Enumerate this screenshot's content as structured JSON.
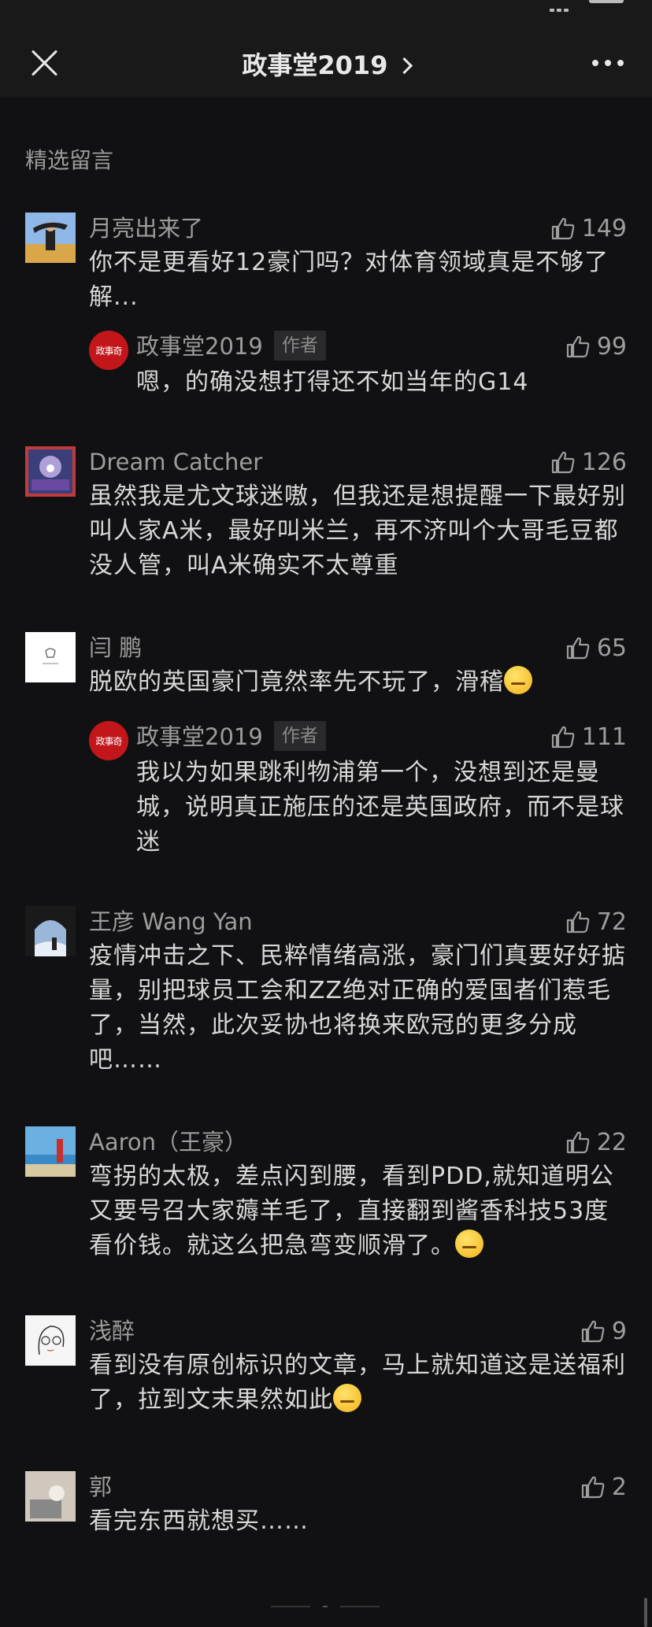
{
  "nav": {
    "title": "政事堂2019"
  },
  "section_title": "精选留言",
  "comments": [
    {
      "name": "月亮出来了",
      "likes": "149",
      "text": "你不是更看好12豪门吗？对体育领域真是不够了解..."
    },
    {
      "name": "政事堂2019",
      "author_tag": "作者",
      "likes": "99",
      "text": "嗯，的确没想打得还不如当年的G14",
      "avatar_text": "政事奇"
    },
    {
      "name": "Dream Catcher",
      "likes": "126",
      "text": "虽然我是尤文球迷嗷，但我还是想提醒一下最好别叫人家A米，最好叫米兰，再不济叫个大哥毛豆都没人管，叫A米确实不太尊重"
    },
    {
      "name": "闫 鹏",
      "likes": "65",
      "text": "脱欧的英国豪门竟然率先不玩了，滑稽"
    },
    {
      "name": "政事堂2019",
      "author_tag": "作者",
      "likes": "111",
      "text": "我以为如果跳利物浦第一个，没想到还是曼城，说明真正施压的还是英国政府，而不是球迷",
      "avatar_text": "政事奇"
    },
    {
      "name": "王彦 Wang Yan",
      "likes": "72",
      "text": "疫情冲击之下、民粹情绪高涨，豪门们真要好好掂量，别把球员工会和ZZ绝对正确的爱国者们惹毛了，当然，此次妥协也将换来欧冠的更多分成吧……"
    },
    {
      "name": "Aaron（王豪）",
      "likes": "22",
      "text": "弯拐的太极，差点闪到腰，看到PDD,就知道明公又要号召大家薅羊毛了，直接翻到酱香科技53度看价钱。就这么把急弯变顺滑了。"
    },
    {
      "name": "浅醉",
      "likes": "9",
      "text": "看到没有原创标识的文章，马上就知道这是送福利了，拉到文末果然如此"
    },
    {
      "name": "郭",
      "likes": "2",
      "text": "看完东西就想买……"
    }
  ]
}
